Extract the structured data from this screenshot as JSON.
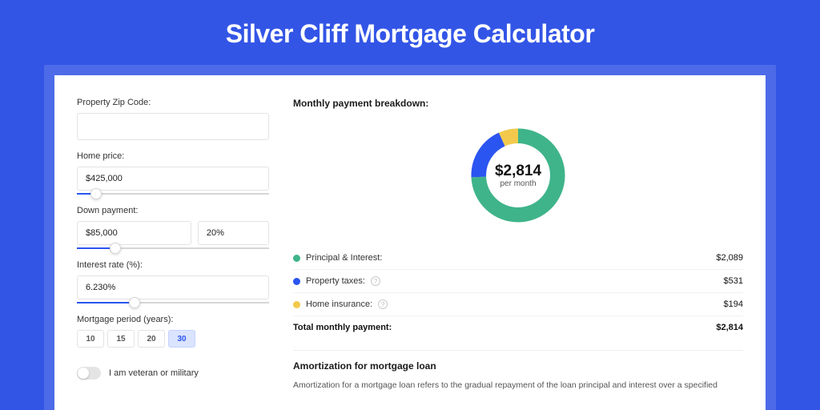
{
  "page": {
    "title": "Silver Cliff Mortgage Calculator"
  },
  "form": {
    "zip": {
      "label": "Property Zip Code:",
      "value": ""
    },
    "homePrice": {
      "label": "Home price:",
      "value": "$425,000",
      "slider": {
        "fillPct": 10,
        "thumbPct": 10
      }
    },
    "downPayment": {
      "label": "Down payment:",
      "amount": "$85,000",
      "percent": "20%",
      "slider": {
        "fillPct": 20,
        "thumbPct": 20
      }
    },
    "interestRate": {
      "label": "Interest rate (%):",
      "value": "6.230%",
      "slider": {
        "fillPct": 30,
        "thumbPct": 30
      }
    },
    "period": {
      "label": "Mortgage period (years):",
      "options": [
        "10",
        "15",
        "20",
        "30"
      ],
      "selected": "30"
    },
    "veteran": {
      "label": "I am veteran or military",
      "on": false
    }
  },
  "breakdown": {
    "title": "Monthly payment breakdown:",
    "donut": {
      "amount": "$2,814",
      "sub": "per month"
    },
    "rows": [
      {
        "label": "Principal & Interest:",
        "value": "$2,089",
        "color": "green",
        "info": false
      },
      {
        "label": "Property taxes:",
        "value": "$531",
        "color": "blue",
        "info": true
      },
      {
        "label": "Home insurance:",
        "value": "$194",
        "color": "yellow",
        "info": true
      }
    ],
    "total": {
      "label": "Total monthly payment:",
      "value": "$2,814"
    }
  },
  "amortization": {
    "title": "Amortization for mortgage loan",
    "text": "Amortization for a mortgage loan refers to the gradual repayment of the loan principal and interest over a specified"
  },
  "chart_data": {
    "type": "pie",
    "title": "Monthly payment breakdown",
    "series": [
      {
        "name": "Principal & Interest",
        "value": 2089,
        "color": "#3fb48a"
      },
      {
        "name": "Property taxes",
        "value": 531,
        "color": "#2b55f0"
      },
      {
        "name": "Home insurance",
        "value": 194,
        "color": "#f2c94c"
      }
    ],
    "total": 2814
  }
}
